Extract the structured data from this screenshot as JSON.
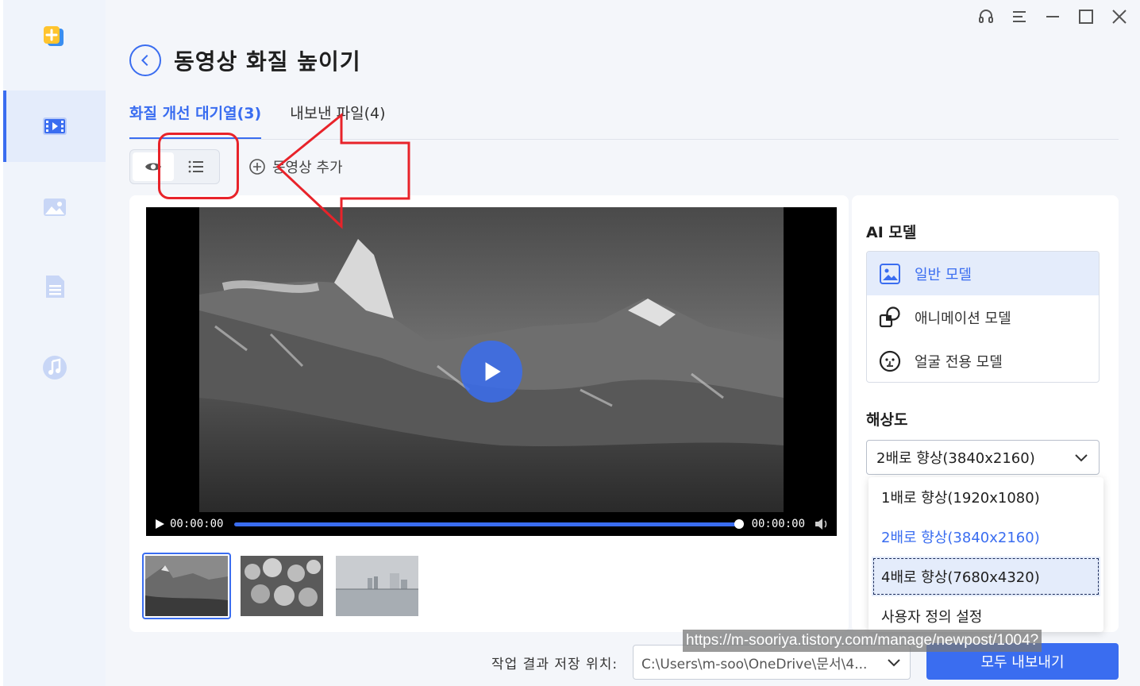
{
  "page": {
    "title": "동영상 화질 높이기"
  },
  "tabs": [
    {
      "label": "화질 개선 대기열(3)",
      "active": true
    },
    {
      "label": "내보낸 파일(4)",
      "active": false
    }
  ],
  "toolbar": {
    "add_video_label": "동영상 추가"
  },
  "sidebar": {
    "items": [
      {
        "icon": "video-enhance-icon",
        "active": true
      },
      {
        "icon": "image-enhance-icon",
        "active": false
      },
      {
        "icon": "document-enhance-icon",
        "active": false
      },
      {
        "icon": "audio-enhance-icon",
        "active": false
      }
    ]
  },
  "window_controls": [
    "headset-icon",
    "menu-icon",
    "minimize-icon",
    "maximize-icon",
    "close-icon"
  ],
  "player": {
    "time_current": "00:00:00",
    "time_total": "00:00:00",
    "progress_fraction": 1.0
  },
  "thumbnails": [
    {
      "icon": "mountain-thumbnail",
      "selected": true
    },
    {
      "icon": "plants-thumbnail",
      "selected": false
    },
    {
      "icon": "city-lake-thumbnail",
      "selected": false
    }
  ],
  "ai_model": {
    "heading": "AI 모델",
    "options": [
      {
        "label": "일반 모델",
        "icon": "image-icon",
        "selected": true
      },
      {
        "label": "애니메이션 모델",
        "icon": "shapes-icon",
        "selected": false
      },
      {
        "label": "얼굴 전용 모델",
        "icon": "face-icon",
        "selected": false
      }
    ]
  },
  "resolution": {
    "heading": "해상도",
    "selected": "2배로 향상(3840x2160)",
    "options": [
      {
        "label": "1배로 향상(1920x1080)"
      },
      {
        "label": "2배로 향상(3840x2160)"
      },
      {
        "label": "4배로 향상(7680x4320)"
      },
      {
        "label": "사용자 정의 설정"
      }
    ]
  },
  "bottom": {
    "save_location_label": "작업 결과 저장 위치:",
    "save_path": "C:\\Users\\m-soo\\OneDrive\\문서\\4...",
    "export_all_label": "모두 내보내기"
  },
  "watermark": "https://m-sooriya.tistory.com/manage/newpost/1004?",
  "colors": {
    "accent": "#3a6df0",
    "annotation": "#e8232a",
    "sidebar_bg": "#f0f4fb",
    "main_bg": "#f4f6fa"
  }
}
